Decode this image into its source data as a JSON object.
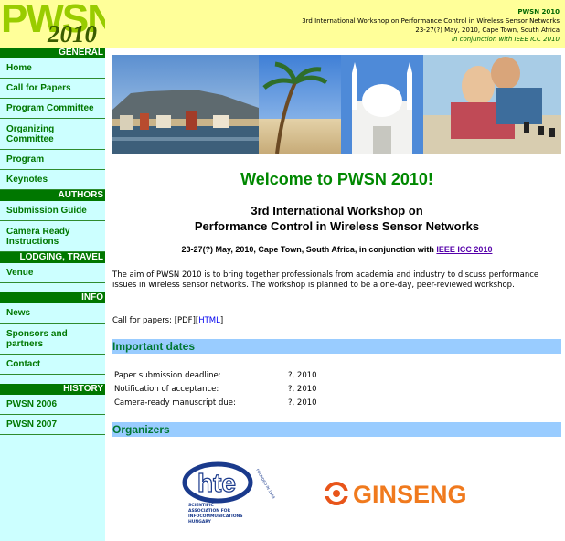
{
  "logo": {
    "text": "PWSN",
    "year": "2010"
  },
  "header": {
    "name": "PWSN 2010",
    "title": "3rd International Workshop on Performance Control in Wireless Sensor Networks",
    "location": "23-27(?) May, 2010, Cape Town, South Africa",
    "conjunction": "in conjunction with IEEE ICC 2010"
  },
  "sidebar": {
    "sections": [
      {
        "header": "GENERAL",
        "items": [
          "Home",
          "Call for Papers",
          "Program Committee",
          "Organizing Committee",
          "Program",
          "Keynotes"
        ]
      },
      {
        "header": "AUTHORS",
        "items": [
          "Submission Guide",
          "Camera Ready Instructions"
        ]
      },
      {
        "header": "LODGING, TRAVEL",
        "items": [
          "Venue"
        ]
      },
      {
        "header": "INFO",
        "items": [
          "News",
          "Sponsors and partners",
          "Contact"
        ]
      },
      {
        "header": "HISTORY",
        "items": [
          "PWSN 2006",
          "PWSN 2007"
        ]
      }
    ]
  },
  "main": {
    "welcome": "Welcome to PWSN 2010!",
    "subtitle_line1": "3rd International Workshop on",
    "subtitle_line2": "Performance Control in Wireless Sensor Networks",
    "dateline_prefix": "23-27(?) May, 2010, Cape Town, South Africa, in conjunction with ",
    "dateline_link": "IEEE ICC 2010",
    "aim": "The aim of PWSN 2010 is to bring together professionals from academia and industry to discuss performance issues in wireless sensor networks. The workshop is planned to be a one-day, peer-reviewed workshop.",
    "cfp_label": "Call for papers: ",
    "cfp_pdf": "[PDF]",
    "cfp_html_open": "[",
    "cfp_html": "HTML",
    "cfp_html_close": "]",
    "important_dates_title": "Important dates",
    "dates": [
      {
        "label": "Paper submission deadline:",
        "value": "?, 2010"
      },
      {
        "label": "Notification of acceptance:",
        "value": "?, 2010"
      },
      {
        "label": "Camera-ready manuscript due:",
        "value": "?, 2010"
      }
    ],
    "organizers_title": "Organizers",
    "hte": {
      "mark": "hte",
      "founded": "FOUNDED IN 1949",
      "line1": "SCIENTIFIC",
      "line2": "ASSOCIATION FOR",
      "line3": "INFOCOMMUNICATIONS",
      "line4": "HUNGARY"
    },
    "ginseng": {
      "mark": "GINSENG"
    }
  },
  "colors": {
    "sidebar_bg": "#ccffff",
    "header_bg": "#ffff99",
    "nav_header_bg": "#007700",
    "section_bar_bg": "#99ccff",
    "welcome_green": "#008800"
  }
}
